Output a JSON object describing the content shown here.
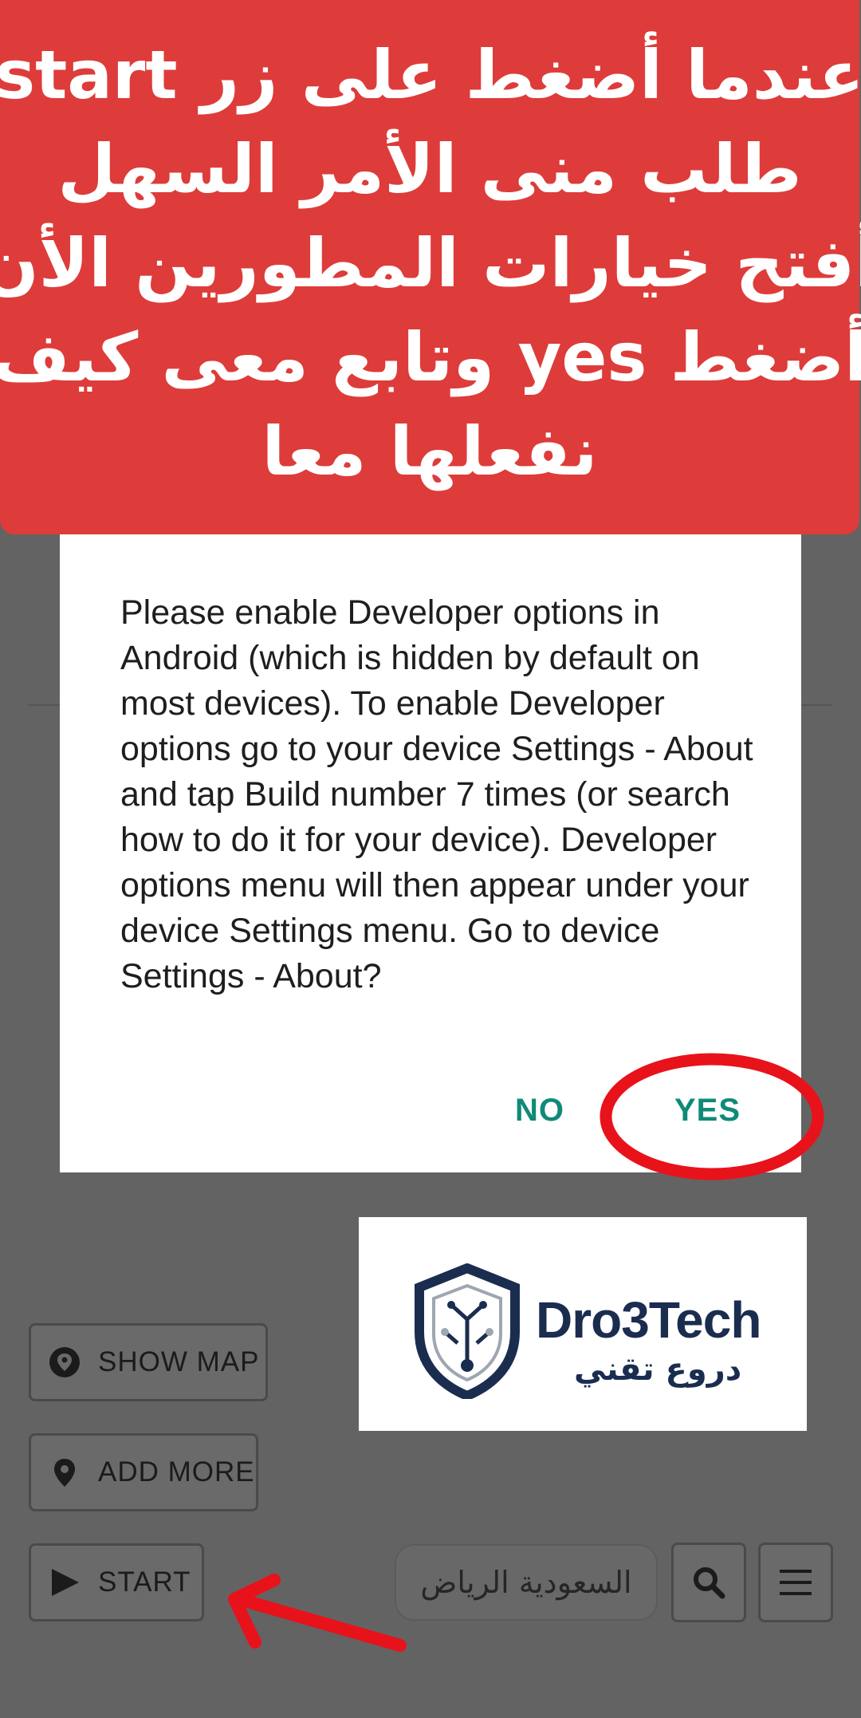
{
  "banner": {
    "lines": [
      "عندما أضغط على زر start",
      "طلب منى الأمر السهل",
      "أفتح خيارات المطورين الأن",
      "أضغط yes وتابع معى كيف",
      "نفعلها معا"
    ],
    "color": "#dd3c3a"
  },
  "dialog": {
    "message": "Please enable Developer options in Android (which is hidden by default on most devices). To enable Developer options go to your device Settings - About and tap Build number 7 times (or search how to do it for your device). Developer options menu will then appear under your device Settings menu. Go to device Settings - About?",
    "no_label": "NO",
    "yes_label": "YES",
    "accent_color": "#0f8a78"
  },
  "logo": {
    "name": "Dro3Tech",
    "arabic_name": "دروع تقني"
  },
  "buttons": {
    "show_map": {
      "label": "SHOW MAP",
      "icon": "map-pin-filled-icon"
    },
    "add_more": {
      "label": "ADD MORE",
      "icon": "map-pin-icon"
    },
    "start": {
      "label": "START",
      "icon": "play-icon"
    }
  },
  "search": {
    "value": "السعودية الرياض",
    "icon": "search-icon"
  },
  "menu": {
    "icon": "hamburger-menu-icon"
  },
  "annotations": {
    "highlight_color": "#e8121b"
  }
}
